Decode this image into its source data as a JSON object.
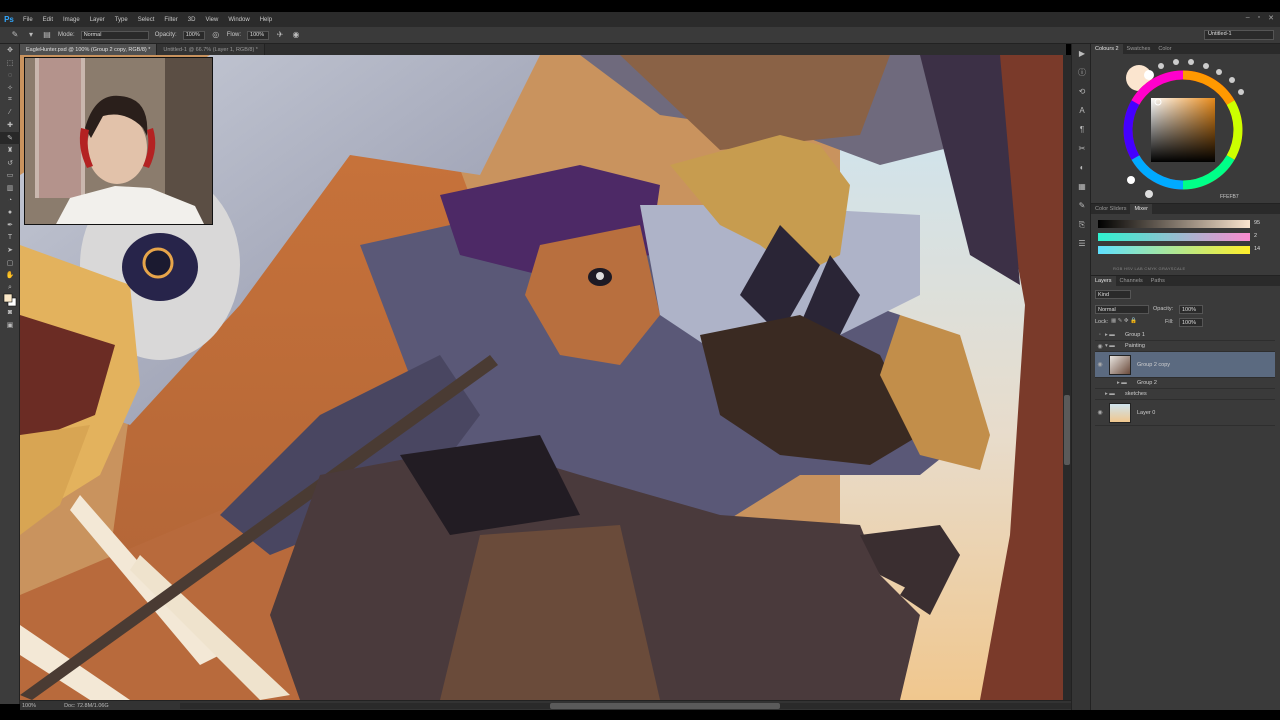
{
  "app": {
    "logo": "Ps"
  },
  "menu": [
    "File",
    "Edit",
    "Image",
    "Layer",
    "Type",
    "Select",
    "Filter",
    "3D",
    "View",
    "Window",
    "Help"
  ],
  "window_controls": [
    "–",
    "▫",
    "✕"
  ],
  "options": {
    "mode_label": "Mode:",
    "mode_value": "Normal",
    "opacity_label": "Opacity:",
    "opacity_value": "100%",
    "flow_label": "Flow:",
    "flow_value": "100%",
    "workspace": "Untitled-1"
  },
  "tabs": [
    {
      "label": "EagleHunter.psd @ 100% (Group 2 copy, RGB/8) *",
      "active": true
    },
    {
      "label": "Untitled-1 @ 66.7% (Layer 1, RGB/8) *",
      "active": false
    }
  ],
  "status": {
    "zoom": "100%",
    "doc": "Doc: 72.8M/1.06G"
  },
  "panels": {
    "colour_tabs": [
      "Colours 2",
      "Swatches",
      "Color"
    ],
    "hex": "FFEFB7",
    "slider_tabs": [
      "Color Sliders",
      "Mixer"
    ],
    "slider_values": [
      "95",
      "2",
      "14"
    ],
    "slider_modes": "RGB  HSV  LAB  CMYK  GRAYSCALE",
    "layer_tabs": [
      "Layers",
      "Channels",
      "Paths"
    ],
    "layer_filter": "Kind",
    "blend_mode": "Normal",
    "opacity_label": "Opacity:",
    "opacity_value": "100%",
    "lock_label": "Lock:",
    "fill_label": "Fill:",
    "fill_value": "100%"
  },
  "layers": [
    {
      "name": "Group 1",
      "type": "group"
    },
    {
      "name": "Painting",
      "type": "group-open"
    },
    {
      "name": "Group 2 copy",
      "type": "layer",
      "selected": true
    },
    {
      "name": "Group 2",
      "type": "group"
    },
    {
      "name": "sketches",
      "type": "group"
    },
    {
      "name": "Layer 0",
      "type": "layer"
    }
  ]
}
